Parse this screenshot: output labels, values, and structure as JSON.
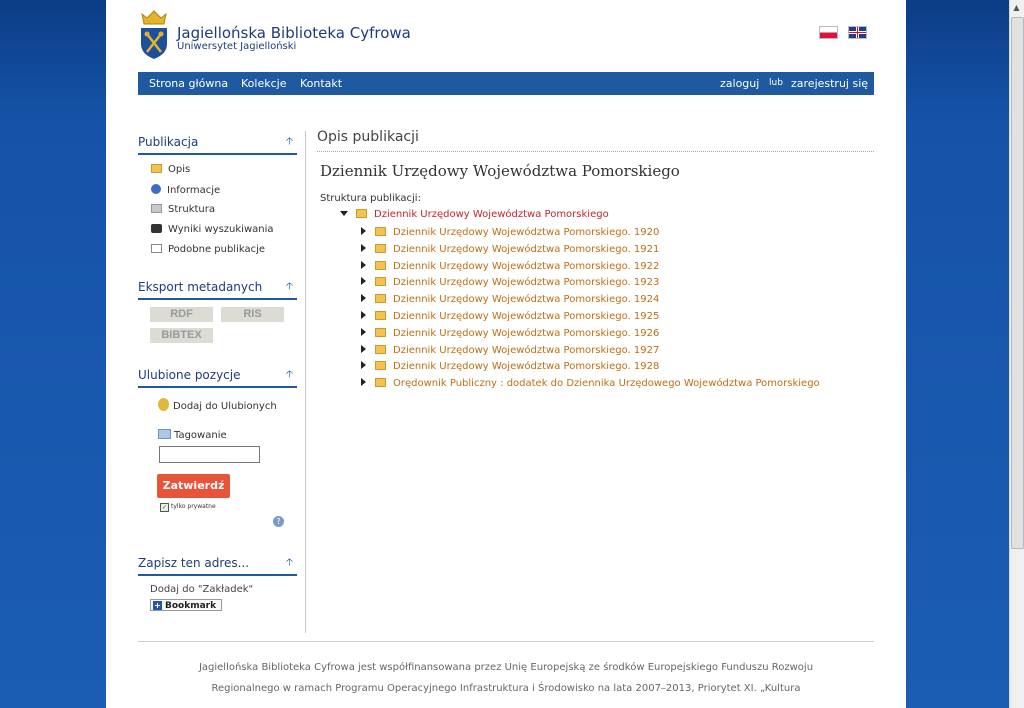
{
  "header": {
    "title": "Jagiellońska Biblioteka Cyfrowa",
    "subtitle": "Uniwersytet Jagielloński"
  },
  "nav": {
    "home": "Strona główna",
    "collections": "Kolekcje",
    "contact": "Kontakt",
    "login": "zaloguj",
    "or": "lub",
    "register": "zarejestruj się"
  },
  "sidebar": {
    "publication": {
      "heading": "Publikacja",
      "items": [
        {
          "label": "Opis",
          "icon": "folder-icon"
        },
        {
          "label": "Informacje",
          "icon": "info-icon"
        },
        {
          "label": "Struktura",
          "icon": "structure-icon"
        },
        {
          "label": "Wyniki wyszukiwania",
          "icon": "binoculars-icon"
        },
        {
          "label": "Podobne publikacje",
          "icon": "pages-icon"
        }
      ]
    },
    "export": {
      "heading": "Eksport metadanych",
      "buttons": [
        "RDF",
        "RIS",
        "BIBTEX"
      ]
    },
    "favorites": {
      "heading": "Ulubione pozycje",
      "add_label": "Dodaj do Ulubionych",
      "tag_label": "Tagowanie",
      "tag_value": "",
      "submit_label": "Zatwierdź",
      "private_label": "tylko prywatne",
      "private_checked": true
    },
    "bookmark": {
      "heading": "Zapisz ten adres...",
      "label": "Dodaj do \"Zakładek\"",
      "button": "Bookmark"
    }
  },
  "main": {
    "section_title": "Opis publikacji",
    "pub_title": "Dziennik Urzędowy Województwa Pomorskiego",
    "structure_label": "Struktura publikacji:",
    "tree": {
      "root": "Dziennik Urzędowy Województwa Pomorskiego",
      "children": [
        "Dziennik Urzędowy Województwa Pomorskiego. 1920",
        "Dziennik Urzędowy Województwa Pomorskiego. 1921",
        "Dziennik Urzędowy Województwa Pomorskiego. 1922",
        "Dziennik Urzędowy Województwa Pomorskiego. 1923",
        "Dziennik Urzędowy Województwa Pomorskiego. 1924",
        "Dziennik Urzędowy Województwa Pomorskiego. 1925",
        "Dziennik Urzędowy Województwa Pomorskiego. 1926",
        "Dziennik Urzędowy Województwa Pomorskiego. 1927",
        "Dziennik Urzędowy Województwa Pomorskiego. 1928",
        "Orędownik Publiczny : dodatek do Dziennika Urzędowego Województwa Pomorskiego"
      ]
    }
  },
  "footer": {
    "line1": "Jagiellońska Biblioteka Cyfrowa jest współfinansowana przez Unię Europejską ze środków Europejskiego Funduszu Rozwoju",
    "line2": "Regionalnego w ramach Programu Operacyjnego Infrastruktura i Środowisko na lata 2007–2013, Priorytet XI. „Kultura"
  },
  "colors": {
    "accent": "#1f5aa1",
    "link_orange": "#c06e13",
    "root_red": "#c0262e",
    "submit": "#e8543a"
  }
}
